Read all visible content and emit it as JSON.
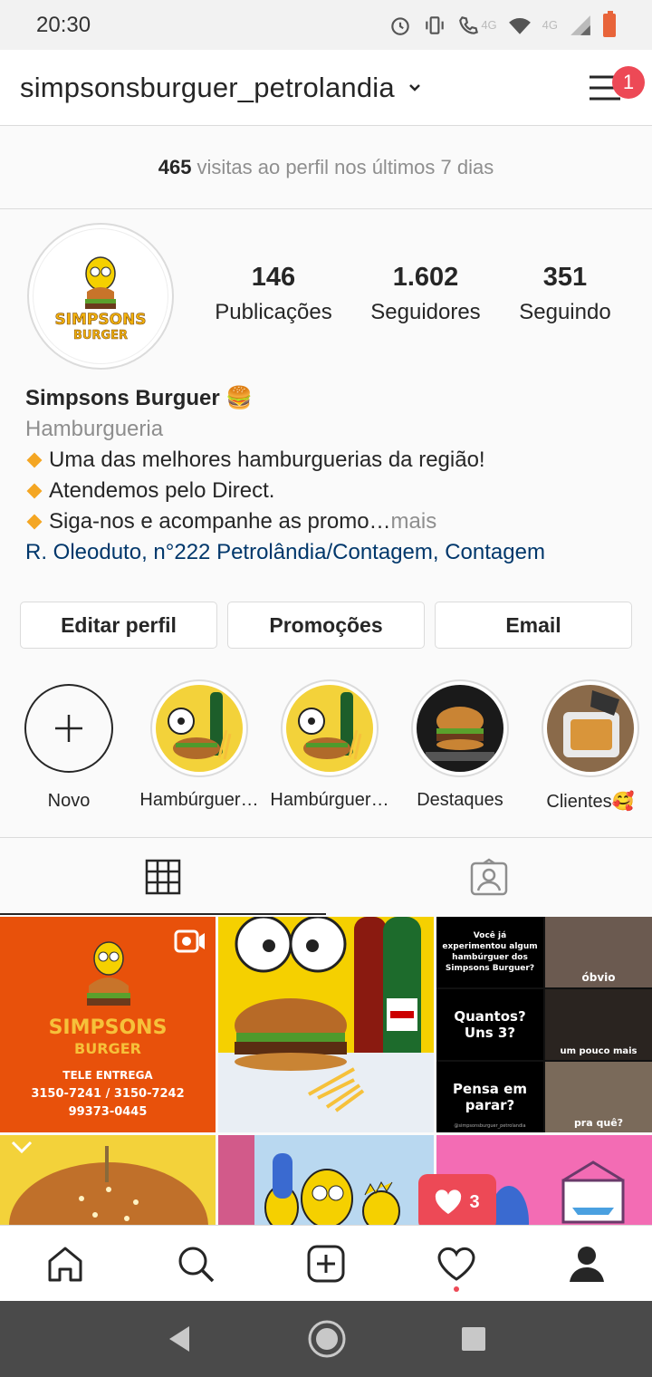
{
  "status_bar": {
    "time": "20:30",
    "network_label": "4G",
    "network_label_2": "4G",
    "icons": [
      "alarm-icon",
      "vibrate-icon",
      "call-4g-icon",
      "wifi-icon",
      "signal-icon",
      "battery-icon"
    ]
  },
  "header": {
    "username": "simpsonsburguer_petrolandia",
    "menu_badge": "1"
  },
  "visits": {
    "count": "465",
    "text": "visitas ao perfil nos últimos 7 dias"
  },
  "profile": {
    "avatar_text_1": "SIMPSONS",
    "avatar_text_2": "BURGER",
    "stats": [
      {
        "value": "146",
        "label": "Publicações"
      },
      {
        "value": "1.602",
        "label": "Seguidores"
      },
      {
        "value": "351",
        "label": "Seguindo"
      }
    ],
    "name": "Simpsons Burguer 🍔",
    "category": "Hamburgueria",
    "bio_lines": [
      "Uma das melhores hamburguerias da região!",
      "Atendemos pelo Direct.",
      "Siga-nos e acompanhe as promo…"
    ],
    "more": " mais",
    "address": "R. Oleoduto, n°222 Petrolândia/Contagem, Contagem"
  },
  "buttons": {
    "edit": "Editar perfil",
    "promotions": "Promoções",
    "email": "Email"
  },
  "highlights": [
    {
      "label": "Novo"
    },
    {
      "label": "Hambúrguer…"
    },
    {
      "label": "Hambúrguer…"
    },
    {
      "label": "Destaques"
    },
    {
      "label": "Clientes🥰"
    }
  ],
  "grid": {
    "post1": {
      "title_1": "SIMPSONS",
      "title_2": "BURGER",
      "line1": "TELE ENTREGA",
      "line2": "3150-7241 / 3150-7242",
      "line3": "99373-0445"
    },
    "post3": {
      "q1": "Você já experimentou algum hambúrguer dos Simpsons Burguer?",
      "a1": "óbvio",
      "q2": "Quantos? Uns 3?",
      "a2": "um pouco mais",
      "q3": "Pensa em parar?",
      "a3": "pra quê?",
      "handle": "@simpsonsburguer_petrolandia"
    }
  },
  "notification": {
    "likes": "3"
  }
}
